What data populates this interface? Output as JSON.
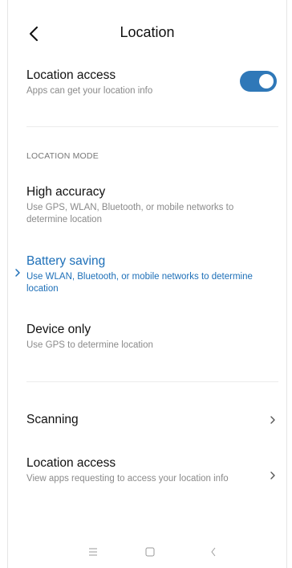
{
  "header": {
    "title": "Location"
  },
  "location_access_toggle": {
    "title": "Location access",
    "subtitle": "Apps can get your location info",
    "enabled": true
  },
  "location_mode": {
    "section_label": "LOCATION MODE",
    "options": [
      {
        "title": "High accuracy",
        "subtitle": "Use GPS, WLAN, Bluetooth, or mobile networks to determine location",
        "selected": false
      },
      {
        "title": "Battery saving",
        "subtitle": "Use WLAN, Bluetooth, or mobile networks to determine location",
        "selected": true
      },
      {
        "title": "Device only",
        "subtitle": "Use GPS to determine location",
        "selected": false
      }
    ]
  },
  "scanning": {
    "title": "Scanning"
  },
  "location_access_apps": {
    "title": "Location access",
    "subtitle": "View apps requesting to access your location info"
  },
  "colors": {
    "accent": "#1d6fb8",
    "toggle_on": "#2f78b8"
  }
}
